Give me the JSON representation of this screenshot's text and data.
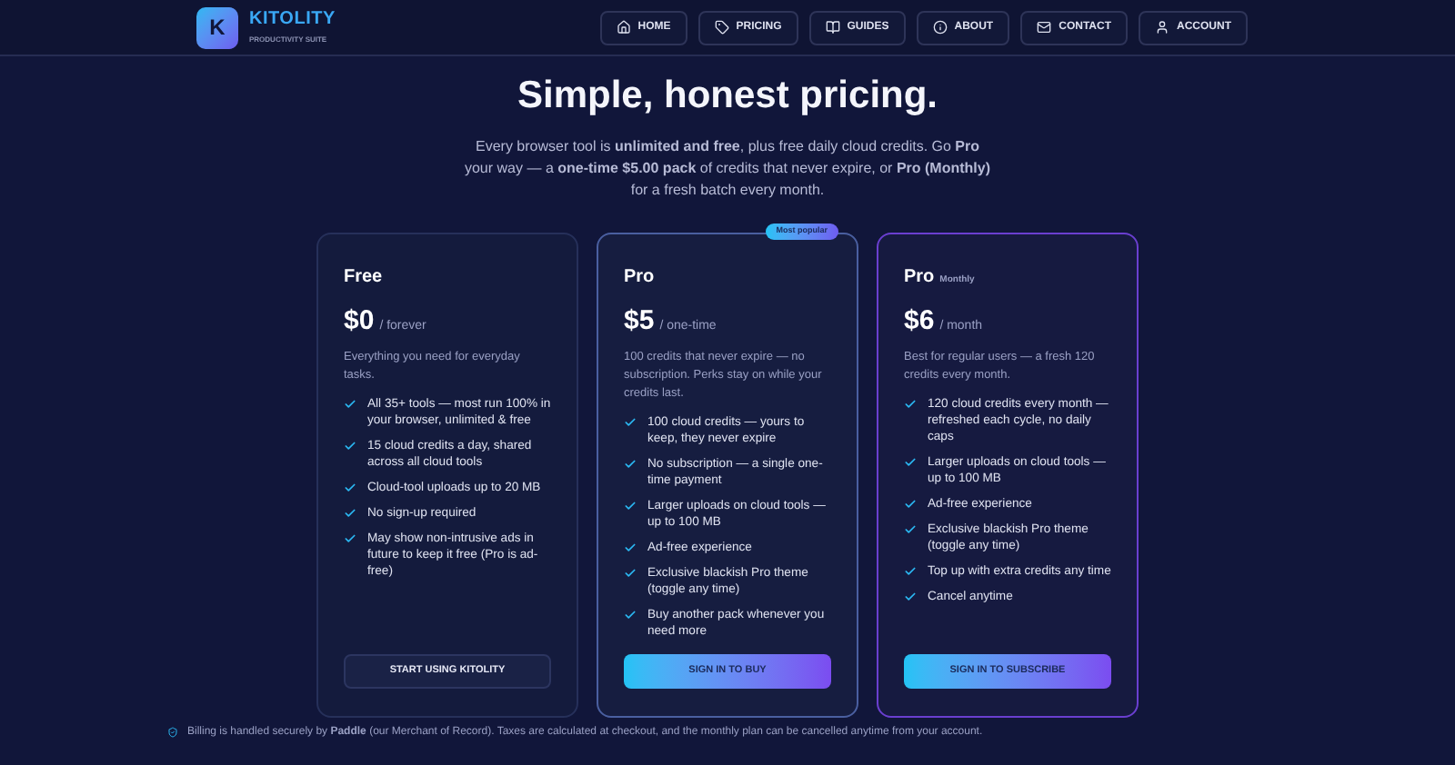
{
  "brand": {
    "logo_letter": "K",
    "name": "KITOLITY",
    "tagline": "PRODUCTIVITY SUITE"
  },
  "nav": [
    {
      "label": "HOME",
      "selected": false
    },
    {
      "label": "PRICING",
      "selected": false
    },
    {
      "label": "GUIDES",
      "selected": false
    },
    {
      "label": "ABOUT",
      "selected": false
    },
    {
      "label": "CONTACT",
      "selected": false
    },
    {
      "label": "ACCOUNT",
      "selected": false
    }
  ],
  "hero": {
    "title": "Simple, honest pricing.",
    "subtitle": "Every browser tool is **unlimited and free**, plus free daily cloud credits. Go **Pro** your way — a **one-time $5.00 pack** of credits that never expire, or **Pro (Monthly)** for a fresh batch every month."
  },
  "plans": [
    {
      "kind": "basic",
      "name": "Free",
      "price": "$0",
      "period": "/ forever",
      "description": "Everything you need for everyday tasks.",
      "features": [
        "All 35+ tools — most run 100% in your browser, unlimited & free",
        "15 cloud credits a day, shared across all cloud tools",
        "Cloud-tool uploads up to 20 MB",
        "No sign-up required",
        "May show non-intrusive ads in future to keep it free (Pro is ad-free)"
      ],
      "cta": "START USING KITOLITY"
    },
    {
      "kind": "popular",
      "badge": "Most popular",
      "name": "Pro",
      "price": "$5",
      "period": "/ one-time",
      "description": "100 credits that never expire — no subscription. Perks stay on while your credits last.",
      "features": [
        "100 cloud credits — yours to keep, they never expire",
        "No subscription — a single one-time payment",
        "Larger uploads on cloud tools — up to 100 MB",
        "Ad-free experience",
        "Exclusive blackish Pro theme (toggle any time)",
        "Buy another pack whenever you need more"
      ],
      "cta": "SIGN IN TO BUY"
    },
    {
      "kind": "subscription",
      "name": "Pro",
      "name_suffix": "Monthly",
      "price": "$6",
      "period": "/ month",
      "description": "Best for regular users — a fresh 120 credits every month.",
      "features": [
        "120 cloud credits every month — refreshed each cycle, no daily caps",
        "Larger uploads on cloud tools — up to 100 MB",
        "Ad-free experience",
        "Exclusive blackish Pro theme (toggle any time)",
        "Top up with extra credits any time",
        "Cancel anytime"
      ],
      "cta": "SIGN IN TO SUBSCRIBE"
    }
  ],
  "footnote": "Billing is handled securely by **Paddle** (our Merchant of Record). Taxes are calculated at checkout, and the monthly plan can be cancelled anytime from your account."
}
